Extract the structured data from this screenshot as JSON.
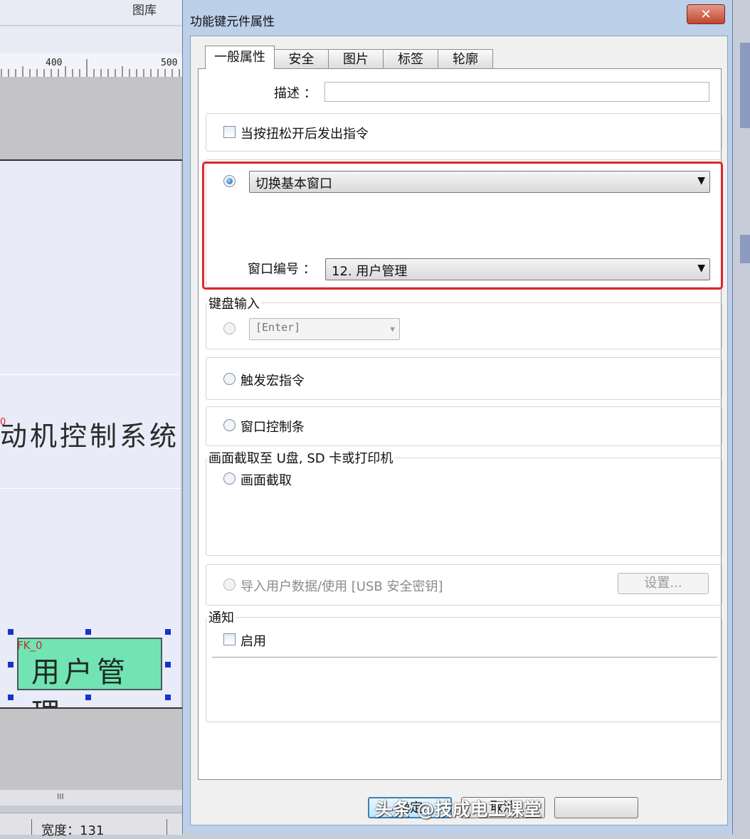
{
  "background": {
    "top_title": "图库",
    "ruler_labels": [
      "400",
      "500"
    ],
    "canvas_text": "动机控制系统",
    "canvas_small_mark": "0",
    "fk_label": "FK_0",
    "fk_button_text": "用户管理",
    "scroll_grip": "III",
    "status_width": "宽度：131"
  },
  "dialog": {
    "title": "功能键元件属性",
    "close_label": "✕",
    "tabs": [
      {
        "label": "一般属性",
        "active": true
      },
      {
        "label": "安全"
      },
      {
        "label": "图片"
      },
      {
        "label": "标签"
      },
      {
        "label": "轮廓"
      }
    ],
    "description_label": "描述 ：",
    "description_value": "",
    "release_checkbox_label": "当按扭松开后发出指令",
    "action_select": "切换基本窗口",
    "window_no_label": "窗口编号 ：",
    "window_no_select": "12. 用户管理",
    "keyboard_group": "键盘输入",
    "keyboard_select": "[Enter]",
    "macro_label": "触发宏指令",
    "window_bar_label": "窗口控制条",
    "capture_group": "画面截取至 U盘, SD 卡或打印机",
    "capture_label": "画面截取",
    "import_label": "导入用户数据/使用 [USB 安全密钥]",
    "settings_button": "设置...",
    "notice_group": "通知",
    "enable_label": "启用",
    "ok_button": "确定",
    "cancel_button": "取消"
  },
  "watermark": "头条 @技成电工课堂",
  "colors": {
    "highlight_border": "#e0262a",
    "fk_button_fill": "#72e3b3",
    "dialog_frame": "#bcd0ea"
  }
}
